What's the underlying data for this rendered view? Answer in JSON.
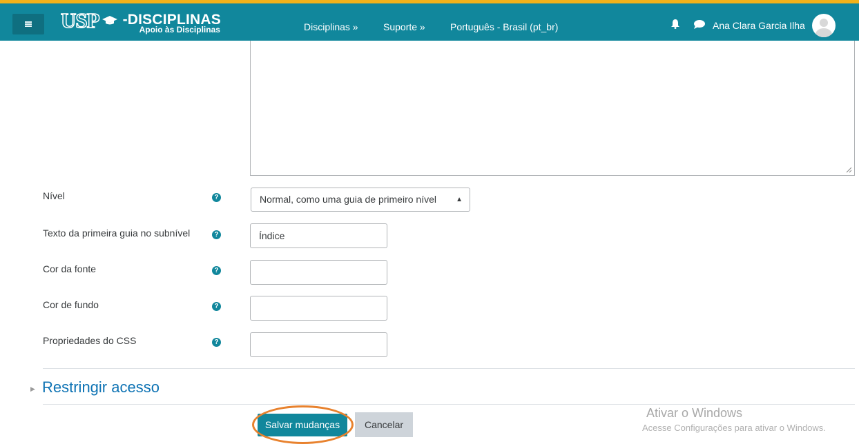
{
  "header": {
    "logo_text": "USP",
    "brand_title": "-DISCIPLINAS",
    "brand_subtitle": "Apoio às Disciplinas",
    "nav_items": [
      "Disciplinas »",
      "Suporte »",
      "Português - Brasil (pt_br)"
    ],
    "user_name": "Ana Clara Garcia Ilha",
    "icons": [
      "menu-icon",
      "graduation-cap-icon",
      "bell-icon",
      "chat-icon",
      "avatar-icon"
    ],
    "colors": {
      "navbar": "#11879c",
      "stripe": "#f2b21a"
    }
  },
  "form": {
    "fields": [
      {
        "label": "Nível",
        "type": "select",
        "value": "Normal, como uma guia de primeiro nível",
        "help": "?"
      },
      {
        "label": "Texto da primeira guia no subnível",
        "type": "text",
        "value": "Índice",
        "help": "?"
      },
      {
        "label": "Cor da fonte",
        "type": "text",
        "value": "",
        "help": "?"
      },
      {
        "label": "Cor de fundo",
        "type": "text",
        "value": "",
        "help": "?"
      },
      {
        "label": "Propriedades do CSS",
        "type": "text",
        "value": "",
        "help": "?"
      }
    ],
    "section_title": "Restringir acesso",
    "save_label": "Salvar mudanças",
    "cancel_label": "Cancelar",
    "colors": {
      "save": "#11879c",
      "highlight": "#e8822e",
      "link": "#0e73b4"
    }
  },
  "watermark": {
    "title": "Ativar o Windows",
    "subtitle": "Acesse Configurações para ativar o Windows."
  }
}
